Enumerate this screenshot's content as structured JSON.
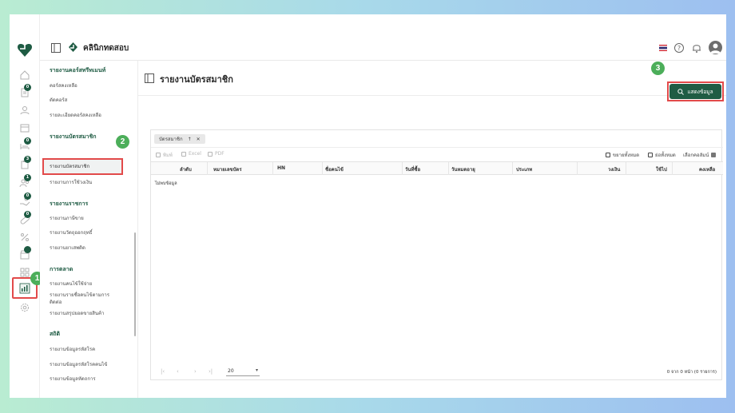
{
  "topbar": {
    "clinic_name": "คลินิกทดสอบ",
    "language_flag": "thai-flag"
  },
  "rail": {
    "items": [
      {
        "icon": "home-icon"
      },
      {
        "icon": "document-icon",
        "badge": "0"
      },
      {
        "icon": "person-icon"
      },
      {
        "icon": "calendar-icon"
      },
      {
        "icon": "bed-icon",
        "badge": "0"
      },
      {
        "icon": "clipboard-icon",
        "badge": "3"
      },
      {
        "icon": "people-icon",
        "badge": "1"
      },
      {
        "icon": "hand-money-icon",
        "badge": "0"
      },
      {
        "icon": "pill-icon",
        "badge": "0"
      },
      {
        "icon": "percent-icon"
      },
      {
        "icon": "shop-icon",
        "badge": ""
      },
      {
        "icon": "apps-icon"
      },
      {
        "icon": "report-chart-icon"
      },
      {
        "icon": "settings-icon"
      }
    ],
    "callout_1": "1"
  },
  "sidebar": {
    "sections": [
      {
        "title": "รายงานคอร์สทรีทเมนท์",
        "items": [
          "คอร์สคงเหลือ",
          "ตัดคอร์ส",
          "รายละเอียดคอร์สคงเหลือ"
        ]
      },
      {
        "title": "รายงานบัตรสมาชิก",
        "items": [
          "รายงานบัตรสมาชิก",
          "รายงานการใช้วงเงิน"
        ]
      },
      {
        "title": "รายงานราชการ",
        "items": [
          "รายงานภาษีขาย",
          "รายงานวัตถุออกฤทธิ์",
          "รายงานยาเสพติด"
        ]
      },
      {
        "title": "การตลาด",
        "items": [
          "รายงานคนไข้ใช้จ่าย",
          "รายงานรายชื่อคนไข้ตามการติดต่อ",
          "รายงานสรุปยอดขายสินค้า"
        ]
      },
      {
        "title": "สถิติ",
        "items": [
          "รายงานข้อมูลรหัสโรค",
          "รายงานข้อมูลรหัสโรคคนไข้",
          "รายงานข้อมูลหัตถการ"
        ]
      }
    ],
    "callout_2": "2"
  },
  "main": {
    "page_title": "รายงานบัตรสมาชิก",
    "show_button": "แสดงข้อมูล",
    "callout_3": "3",
    "grouping_chip": "บัตรสมาชิก",
    "chip_sort": "↑",
    "chip_close": "✕",
    "toolbar": {
      "print": "พิมพ์",
      "excel": "Excel",
      "pdf": "PDF",
      "expand_all": "ขยายทั้งหมด",
      "collapse_all": "ย่อทั้งหมด",
      "choose_columns": "เลือกคอลัมน์"
    },
    "columns": [
      "ลำดับ",
      "หมายเลขบัตร",
      "HN",
      "ชื่อคนไข้",
      "วันที่ซื้อ",
      "วันหมดอายุ",
      "ประเภท",
      "วงเงิน",
      "ใช้ไป",
      "คงเหลือ"
    ],
    "no_data": "ไม่พบข้อมูล",
    "pager": {
      "page_size": "20",
      "info": "0 จาก 0 หน้า (0 รายการ)"
    }
  }
}
